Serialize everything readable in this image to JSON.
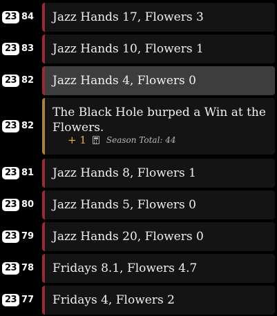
{
  "rows": [
    {
      "badge": "23",
      "inning": "84",
      "text": "Jazz Hands 17, Flowers 3"
    },
    {
      "badge": "23",
      "inning": "83",
      "text": "Jazz Hands 10, Flowers 1"
    },
    {
      "badge": "23",
      "inning": "82",
      "text": "Jazz Hands 4, Flowers 0"
    },
    {
      "badge": "23",
      "inning": "82",
      "text": "The Black Hole burped a Win at the Flowers.",
      "delta": "+ 1",
      "calc_icon": "calculator-icon",
      "season_total": "Season Total: 44"
    },
    {
      "badge": "23",
      "inning": "81",
      "text": "Jazz Hands 8, Flowers 1"
    },
    {
      "badge": "23",
      "inning": "80",
      "text": "Jazz Hands 5, Flowers 0"
    },
    {
      "badge": "23",
      "inning": "79",
      "text": "Jazz Hands 20, Flowers 0"
    },
    {
      "badge": "23",
      "inning": "78",
      "text": "Fridays 8.1, Flowers 4.7"
    },
    {
      "badge": "23",
      "inning": "77",
      "text": "Fridays 4, Flowers 2"
    }
  ],
  "colors": {
    "background": "#000000",
    "card": "#141414",
    "card_selected": "#3d3d3d",
    "accent_score": "#9c2a35",
    "accent_event": "#a8823e",
    "delta": "#e8b24a"
  }
}
